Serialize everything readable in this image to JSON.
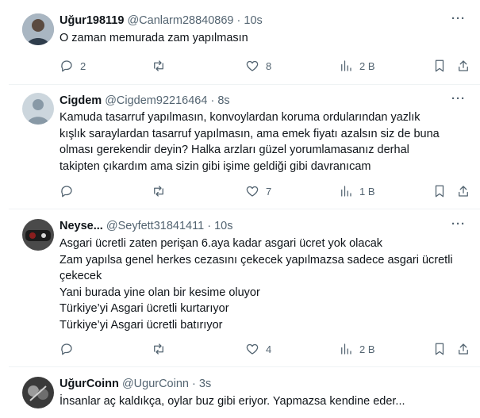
{
  "tweets": [
    {
      "name": "Uğur198119",
      "handle": "@Canlarm28840869",
      "time": "10s",
      "text": [
        "O zaman memurada zam yapılmasın"
      ],
      "replies": "2",
      "retweets": "",
      "likes": "8",
      "views": "2 B",
      "avatar_color": "#6b7a8c"
    },
    {
      "name": "Cigdem",
      "handle": "@Cigdem92216464",
      "time": "8s",
      "text": [
        "Kamuda tasarruf yapılmasın, konvoylardan koruma ordularından yazlık",
        "kışlık saraylardan tasarruf yapılmasın, ama emek fiyatı azalsın siz de buna",
        "olması gerekendir deyin? Halka arzları güzel yorumlamasanız derhal",
        "takipten çıkardım ama sizin gibi işime geldiği gibi davranıcam"
      ],
      "replies": "",
      "retweets": "",
      "likes": "7",
      "views": "1 B",
      "avatar_color": "#c8ced4"
    },
    {
      "name": "Neyse...",
      "handle": "@Seyfett31841411",
      "time": "10s",
      "text": [
        "Asgari ücretli zaten perişan 6.aya kadar asgari ücret yok olacak",
        "Zam yapılsa genel herkes cezasını çekecek yapılmazsa sadece asgari ücretli",
        "çekecek",
        "Yani burada yine olan bir kesime oluyor",
        "Türkiye’yi Asgari ücretli kurtarıyor",
        "Türkiye’yi Asgari ücretli batırıyor"
      ],
      "replies": "",
      "retweets": "",
      "likes": "4",
      "views": "2 B",
      "avatar_color": "#3a3a3a"
    },
    {
      "name": "UğurCoinn",
      "handle": "@UgurCoinn",
      "time": "3s",
      "text": [
        "İnsanlar aç kaldıkça, oylar buz gibi eriyor. Yapmazsa kendine eder..."
      ],
      "avatar_color": "#2b2b2b"
    }
  ],
  "separator": "·",
  "more_label": "···"
}
